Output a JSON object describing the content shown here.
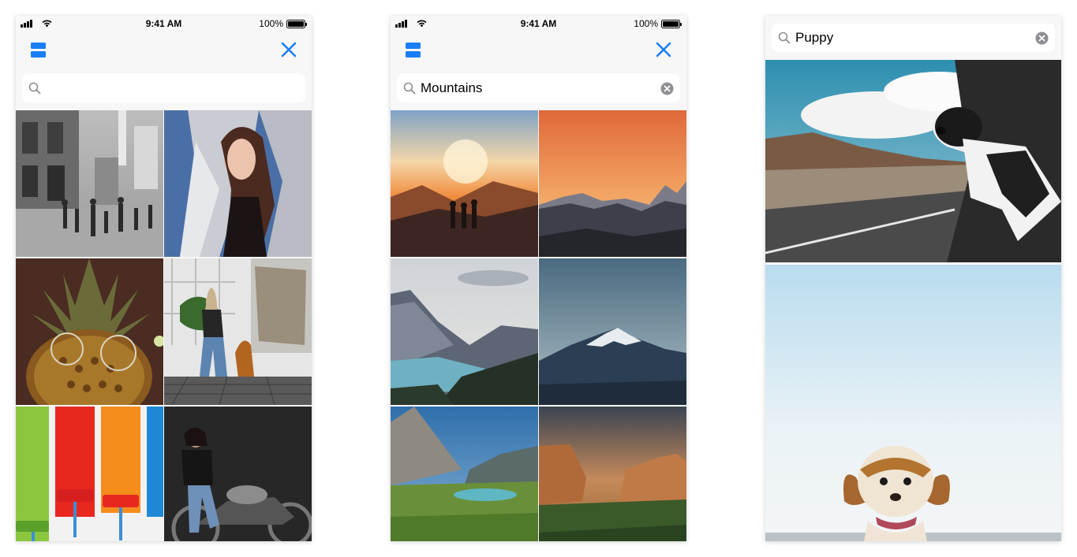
{
  "status_bar": {
    "time": "9:41 AM",
    "battery": "100%"
  },
  "icons": {
    "layout": "layout-toggle-icon",
    "close": "close-icon",
    "search": "search-icon",
    "clear": "clear-icon"
  },
  "accent_color": "#1a7ef5",
  "screens": [
    {
      "search_value": "",
      "photos": [
        "street-crowd",
        "woman-foil-jacket",
        "pineapple-sunglasses",
        "woman-dog-porch",
        "paint-rollers",
        "woman-motorcycle"
      ]
    },
    {
      "search_value": "Mountains",
      "photos": [
        "hikers-sunset",
        "orange-sky-peaks",
        "mountain-lake",
        "snowy-peak-dusk",
        "alpine-meadow-lake",
        "canyon-sunset"
      ]
    },
    {
      "search_value": "Puppy",
      "photos": [
        "dog-car-window",
        "spaniel-puppy-sky"
      ]
    }
  ]
}
